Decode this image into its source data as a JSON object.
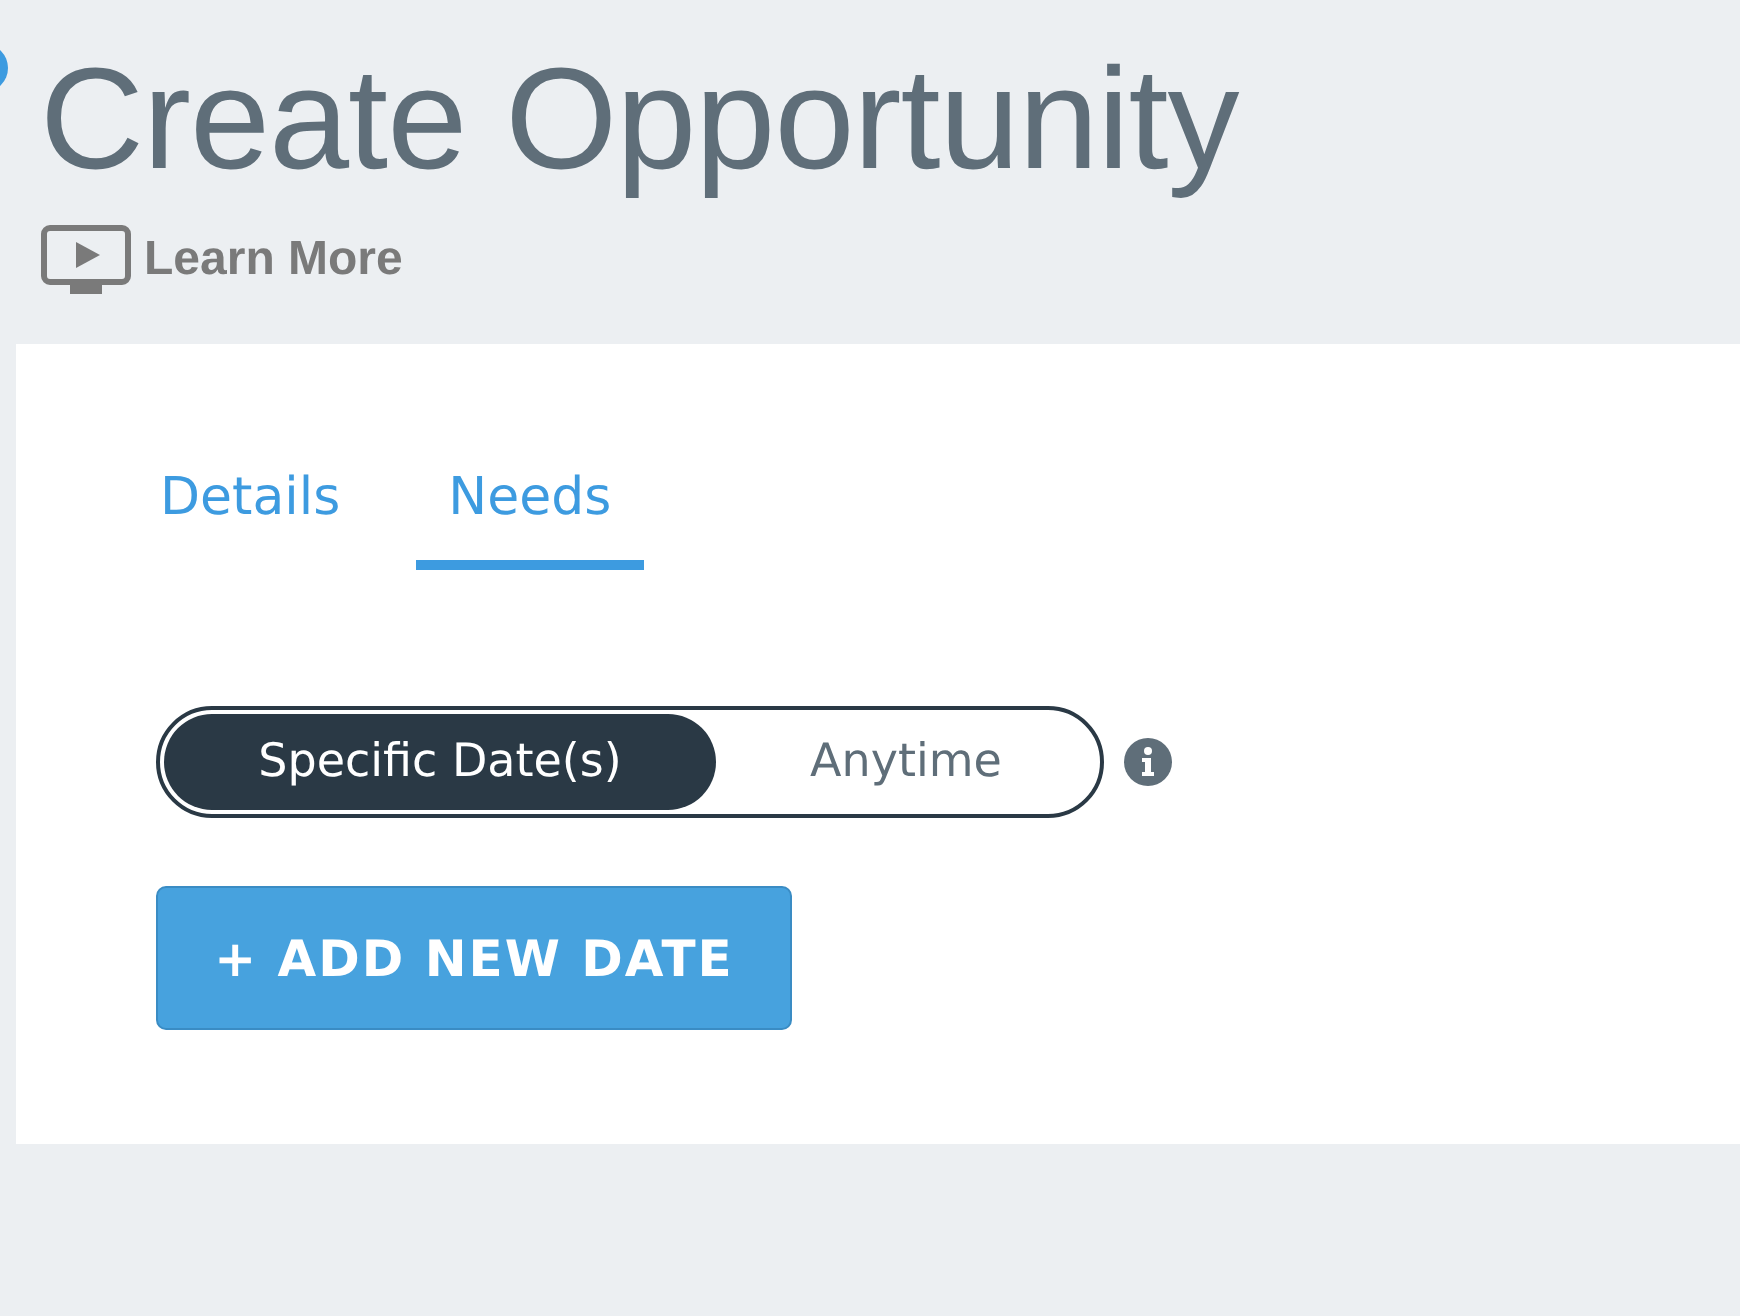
{
  "page": {
    "title": "Create Opportunity",
    "learn_more": "Learn More"
  },
  "tabs": [
    {
      "label": "Details",
      "selected": false
    },
    {
      "label": "Needs",
      "selected": true
    }
  ],
  "date_mode": [
    {
      "label": "Specific Date(s)",
      "selected": true
    },
    {
      "label": "Anytime",
      "selected": false
    }
  ],
  "add_button": "+ ADD NEW DATE"
}
